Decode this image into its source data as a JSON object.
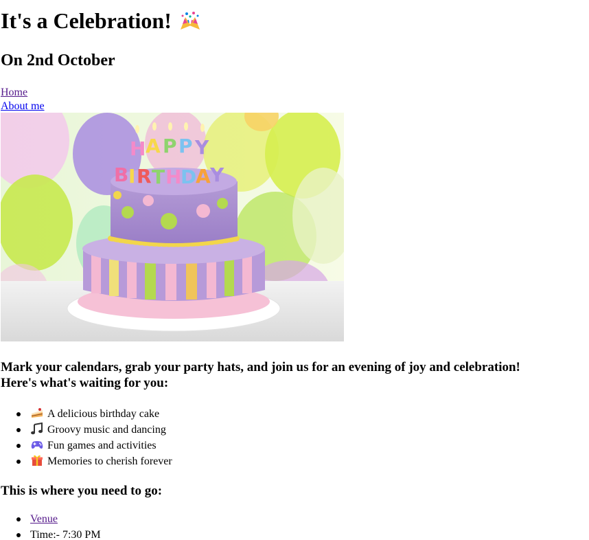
{
  "header": {
    "title": "It's a Celebration!",
    "title_emoji": "party-popper-icon",
    "subtitle": "On 2nd October"
  },
  "nav": {
    "home": "Home",
    "about": "About me"
  },
  "hero": {
    "cake_text_line1": "HAPPY",
    "cake_text_line2": "BIRTHDAY"
  },
  "intro": {
    "line1": "Mark your calendars, grab your party hats, and join us for an evening of joy and celebration!",
    "line2": "Here's what's waiting for you:"
  },
  "perks": [
    {
      "icon": "cake-icon",
      "text": "A delicious birthday cake"
    },
    {
      "icon": "music-notes-icon",
      "text": "Groovy music and dancing"
    },
    {
      "icon": "game-controller-icon",
      "text": "Fun games and activities"
    },
    {
      "icon": "gift-icon",
      "text": "Memories to cherish forever"
    }
  ],
  "where": {
    "heading": "This is where you need to go:",
    "venue_link": "Venue",
    "time": "Time:- 7:30 PM"
  },
  "colors": {
    "link": "#0000ee",
    "link_visited": "#551a8b"
  }
}
